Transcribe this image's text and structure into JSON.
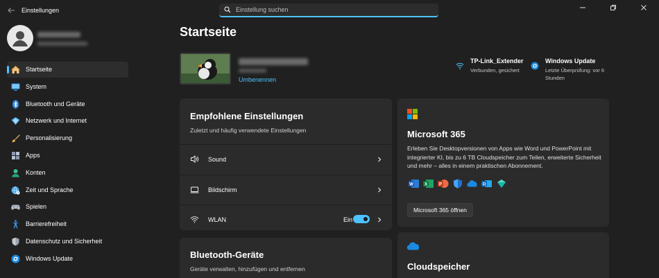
{
  "window": {
    "title": "Einstellungen",
    "controls": {
      "minimize": "—",
      "maximize": "❐",
      "close": "✕"
    }
  },
  "search": {
    "placeholder": "Einstellung suchen"
  },
  "colors": {
    "accent": "#4cc2ff",
    "background": "#202020",
    "card": "#2b2b2b"
  },
  "sidebar": {
    "items": [
      {
        "label": "Startseite",
        "icon": "home-icon",
        "active": true
      },
      {
        "label": "System",
        "icon": "system-icon"
      },
      {
        "label": "Bluetooth und Geräte",
        "icon": "bluetooth-icon"
      },
      {
        "label": "Netzwerk und Internet",
        "icon": "network-icon"
      },
      {
        "label": "Personalisierung",
        "icon": "brush-icon"
      },
      {
        "label": "Apps",
        "icon": "apps-icon"
      },
      {
        "label": "Konten",
        "icon": "accounts-icon"
      },
      {
        "label": "Zeit und Sprache",
        "icon": "time-language-icon"
      },
      {
        "label": "Spielen",
        "icon": "gaming-icon"
      },
      {
        "label": "Barrierefreiheit",
        "icon": "accessibility-icon"
      },
      {
        "label": "Datenschutz und Sicherheit",
        "icon": "shield-icon"
      },
      {
        "label": "Windows Update",
        "icon": "windows-update-icon"
      }
    ]
  },
  "main": {
    "title": "Startseite",
    "device": {
      "rename_label": "Umbenennen"
    },
    "status": {
      "network": {
        "title": "TP-Link_Extender",
        "subtitle": "Verbunden, gesichert"
      },
      "update": {
        "title": "Windows Update",
        "subtitle": "Letzte Überprüfung: vor 6 Stunden"
      }
    },
    "recommended": {
      "title": "Empfohlene Einstellungen",
      "subtitle": "Zuletzt und häufig verwendete Einstellungen",
      "rows": [
        {
          "label": "Sound",
          "icon": "speaker-icon"
        },
        {
          "label": "Bildschirm",
          "icon": "monitor-icon"
        },
        {
          "label": "WLAN",
          "icon": "wifi-icon",
          "toggle_label": "Ein",
          "toggle_on": true
        }
      ]
    },
    "bluetooth": {
      "title": "Bluetooth-Geräte",
      "subtitle": "Geräte verwalten, hinzufügen und entfernen"
    },
    "m365": {
      "title": "Microsoft 365",
      "description": "Erleben Sie Desktopversionen von Apps wie Word und PowerPoint mit integrierter KI, bis zu 6 TB Cloudspeicher zum Teilen, erweiterte Sicherheit und mehr – alles in einem praktischen Abonnement.",
      "button": "Microsoft 365 öffnen",
      "apps": [
        "word-icon",
        "excel-icon",
        "powerpoint-icon",
        "defender-icon",
        "onedrive-icon",
        "outlook-icon",
        "clipchamp-icon"
      ]
    },
    "cloud": {
      "title": "Cloudspeicher"
    }
  }
}
